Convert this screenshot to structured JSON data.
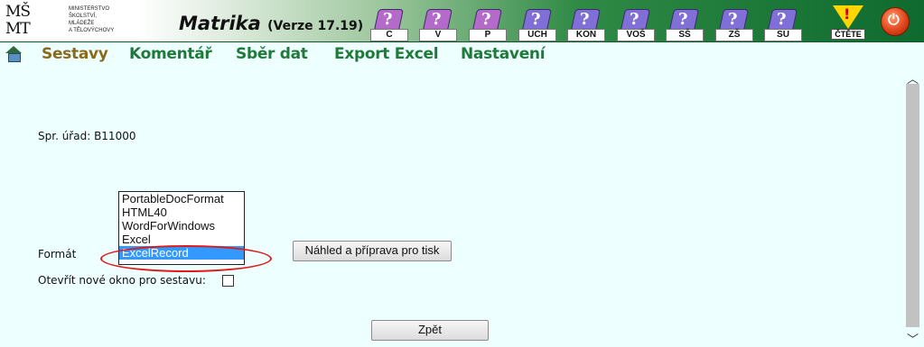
{
  "header": {
    "logo_letters": "MŠ\nMT",
    "logo_text": [
      "Ministerstvo",
      "Školství,",
      "Mládeže",
      "a Tělovýchovy"
    ],
    "app_title": "Matrika",
    "app_version": "(Verze 17.19)",
    "tools": [
      {
        "label": "C",
        "color": "#b36ac9"
      },
      {
        "label": "V",
        "color": "#b36ac9"
      },
      {
        "label": "P",
        "color": "#b36ac9"
      },
      {
        "label": "UCH",
        "color": "#7f6fd6"
      },
      {
        "label": "KON",
        "color": "#7f6fd6"
      },
      {
        "label": "VOŠ",
        "color": "#7f6fd6"
      },
      {
        "label": "SŠ",
        "color": "#7f6fd6"
      },
      {
        "label": "ZŠ",
        "color": "#7f6fd6"
      },
      {
        "label": "SU",
        "color": "#7f6fd6"
      }
    ],
    "warn_label": "ČTĚTE",
    "power_icon": "power-icon"
  },
  "menu": {
    "items": [
      "Sestavy",
      "Komentář",
      "Sběr dat",
      "Export Excel",
      "Nastavení"
    ],
    "active": "Sestavy"
  },
  "form": {
    "office_label": "Spr. úřad: B11000",
    "format_label": "Formát",
    "format_options": [
      "PortableDocFormat",
      "HTML40",
      "WordForWindows",
      "Excel",
      "ExcelRecord"
    ],
    "format_selected": "ExcelRecord",
    "preview_button": "Náhled a příprava pro tisk",
    "new_window_label": "Otevřít nové okno pro sestavu:",
    "new_window_checked": false,
    "back_button": "Zpět"
  },
  "colors": {
    "menu_green": "#1f7a3a",
    "menu_active": "#8a6a1a",
    "selection": "#3399ff",
    "annotation_red": "#e01a1a"
  }
}
